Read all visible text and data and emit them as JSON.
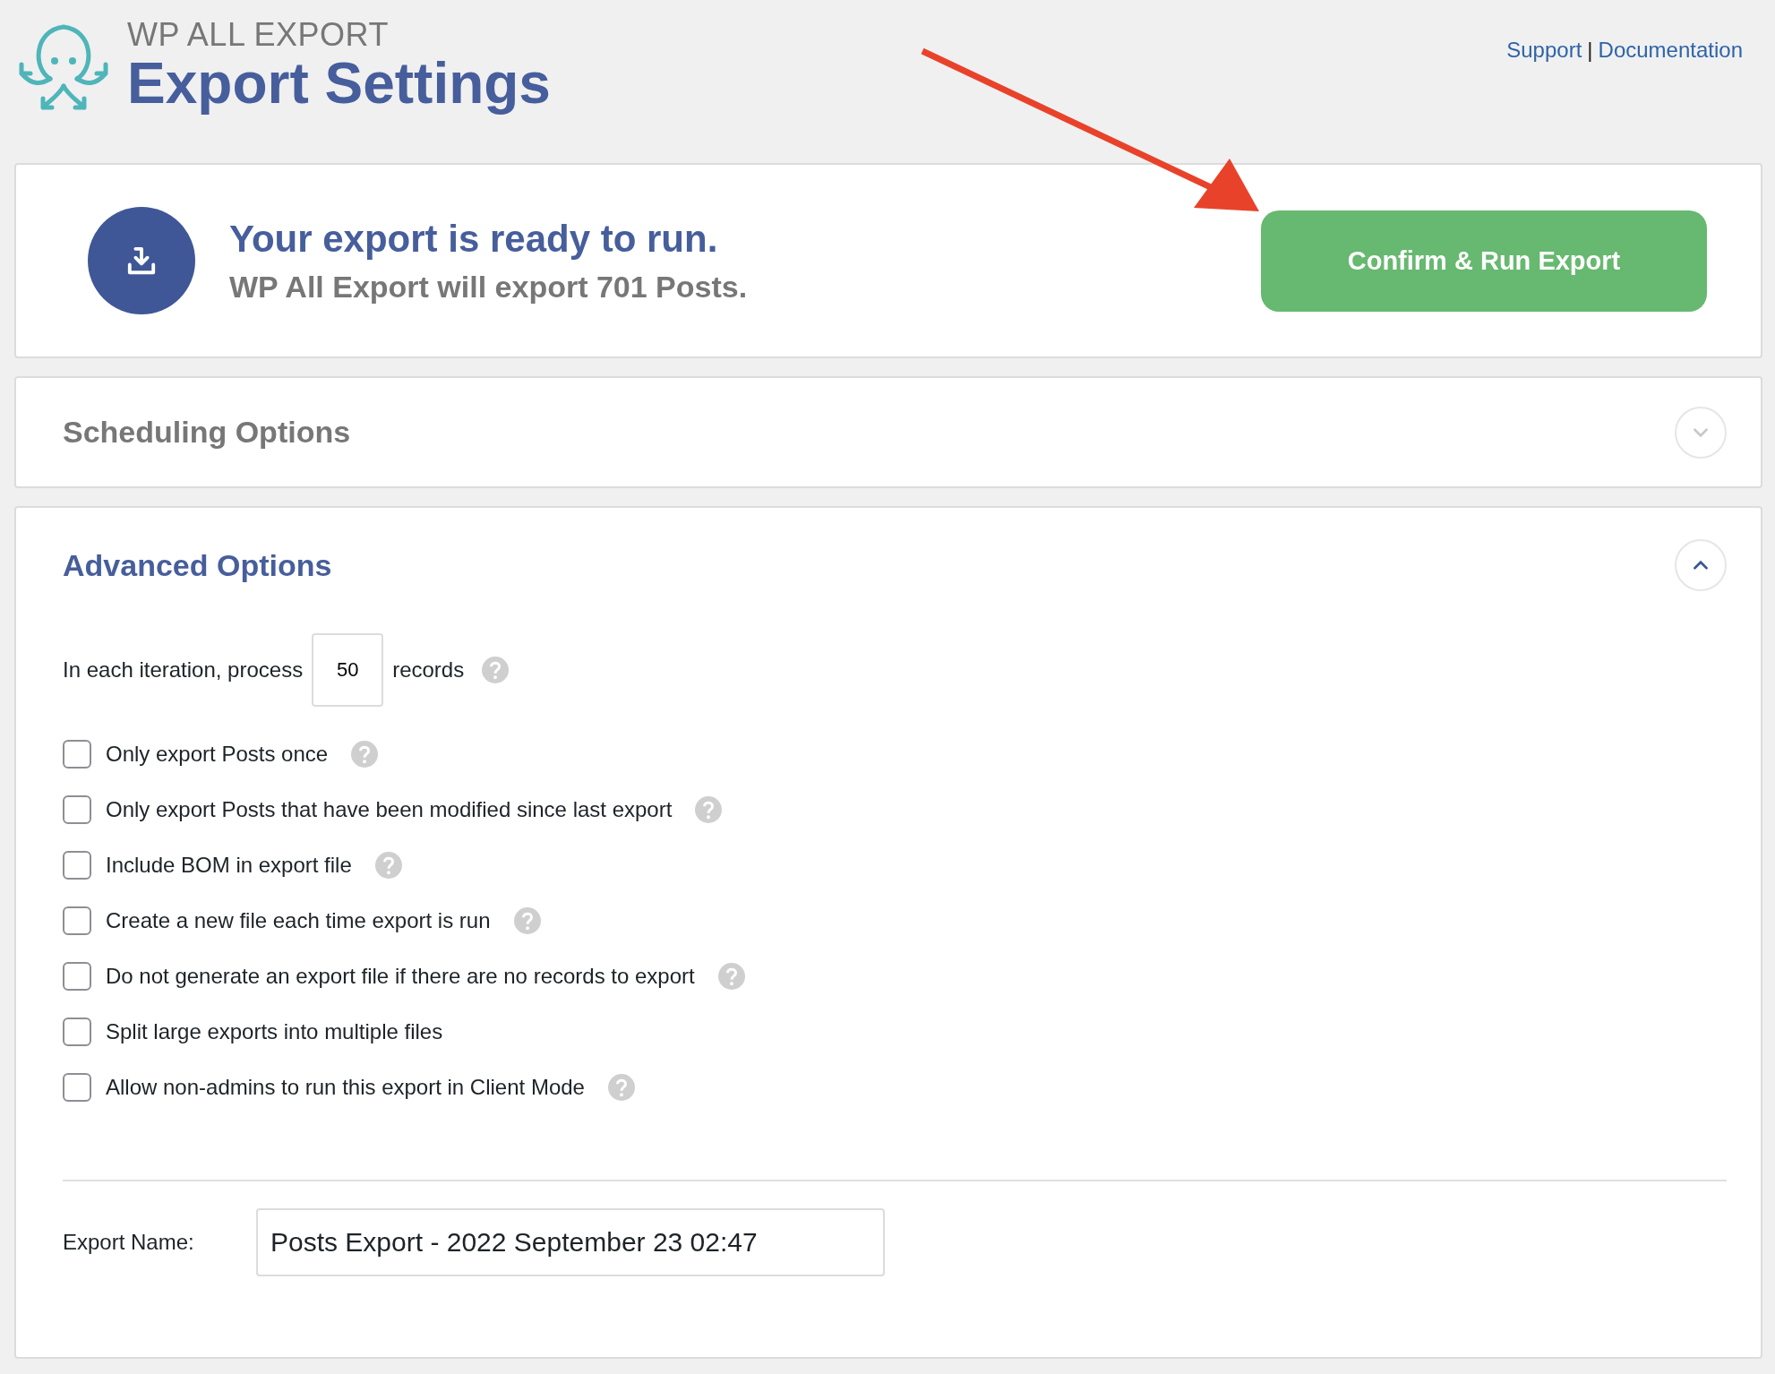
{
  "header": {
    "brand": "WP ALL EXPORT",
    "title": "Export Settings",
    "links": [
      {
        "label": "Support"
      },
      {
        "label": "Documentation"
      }
    ],
    "link_separator": "|"
  },
  "ready": {
    "title": "Your export is ready to run.",
    "subtitle": "WP All Export will export 701 Posts.",
    "button": "Confirm & Run Export"
  },
  "sections": [
    {
      "title": "Scheduling Options",
      "expanded": false
    },
    {
      "title": "Advanced Options",
      "expanded": true,
      "iteration": {
        "prefix": "In each iteration, process",
        "value": "50",
        "suffix": "records",
        "help": true
      },
      "options": [
        {
          "label": "Only export Posts once",
          "checked": false,
          "help": true
        },
        {
          "label": "Only export Posts that have been modified since last export",
          "checked": false,
          "help": true
        },
        {
          "label": "Include BOM in export file",
          "checked": false,
          "help": true
        },
        {
          "label": "Create a new file each time export is run",
          "checked": false,
          "help": true
        },
        {
          "label": "Do not generate an export file if there are no records to export",
          "checked": false,
          "help": true
        },
        {
          "label": "Split large exports into multiple files",
          "checked": false,
          "help": false
        },
        {
          "label": "Allow non-admins to run this export in Client Mode",
          "checked": false,
          "help": true
        }
      ],
      "export_name": {
        "label": "Export Name:",
        "value": "Posts Export - 2022 September 23 02:47"
      }
    }
  ]
}
